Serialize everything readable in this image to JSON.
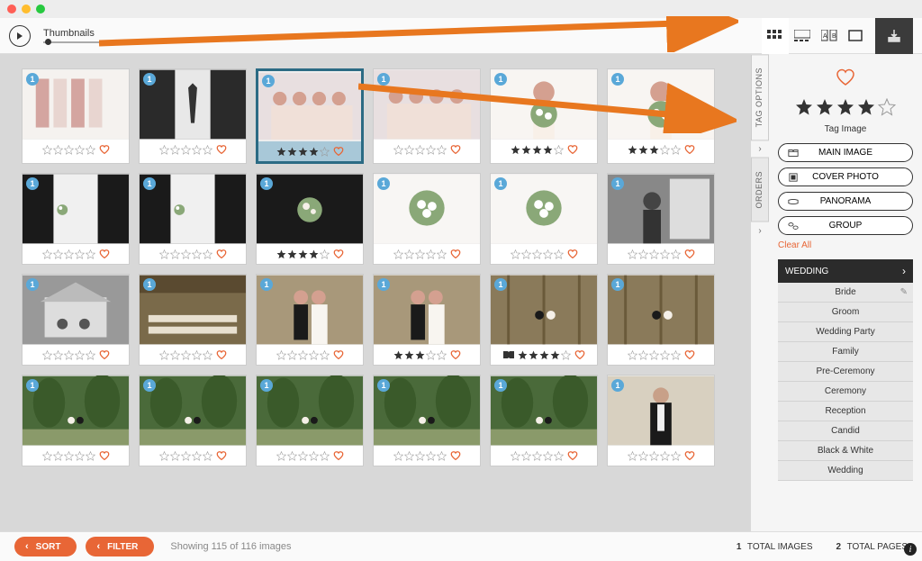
{
  "toolbar": {
    "thumbnails_label": "Thumbnails"
  },
  "side": {
    "tab_tag": "TAG OPTIONS",
    "tab_orders": "ORDERS",
    "tag_image_label": "Tag Image",
    "btn_main": "MAIN IMAGE",
    "btn_cover": "COVER PHOTO",
    "btn_pano": "PANORAMA",
    "btn_group": "GROUP",
    "clear_all": "Clear All",
    "category_header": "WEDDING",
    "categories": [
      "Bride",
      "Groom",
      "Wedding Party",
      "Family",
      "Pre-Ceremony",
      "Ceremony",
      "Reception",
      "Candid",
      "Black & White",
      "Wedding"
    ]
  },
  "footer": {
    "sort": "SORT",
    "filter": "FILTER",
    "status": "Showing 115 of 116 images",
    "total_images_n": "1",
    "total_images": "TOTAL IMAGES",
    "total_pages_n": "2",
    "total_pages": "TOTAL PAGES"
  },
  "thumbnails": [
    {
      "badge": "1",
      "rating": 0,
      "type": "dresses"
    },
    {
      "badge": "1",
      "rating": 0,
      "type": "groom-tie"
    },
    {
      "badge": "1",
      "rating": 4,
      "type": "bridesmaids",
      "selected": true
    },
    {
      "badge": "1",
      "rating": 0,
      "type": "bridesmaids2"
    },
    {
      "badge": "1",
      "rating": 4,
      "type": "bride-bouquet"
    },
    {
      "badge": "1",
      "rating": 3,
      "type": "bride-bouquet2"
    },
    {
      "badge": "1",
      "rating": 0,
      "type": "groom-pin"
    },
    {
      "badge": "1",
      "rating": 0,
      "type": "groom-pin2"
    },
    {
      "badge": "1",
      "rating": 4,
      "type": "bouton"
    },
    {
      "badge": "1",
      "rating": 0,
      "type": "bouquet-white"
    },
    {
      "badge": "1",
      "rating": 0,
      "type": "bouquet-white2"
    },
    {
      "badge": "1",
      "rating": 0,
      "type": "bride-window"
    },
    {
      "badge": "1",
      "rating": 0,
      "type": "house-bw"
    },
    {
      "badge": "1",
      "rating": 0,
      "type": "tables"
    },
    {
      "badge": "1",
      "rating": 0,
      "type": "couple-bouquet"
    },
    {
      "badge": "1",
      "rating": 3,
      "type": "couple-kiss"
    },
    {
      "badge": "1",
      "rating": 4,
      "type": "barn-couple",
      "book": true
    },
    {
      "badge": "1",
      "rating": 0,
      "type": "barn-window"
    },
    {
      "badge": "1",
      "rating": 0,
      "type": "field1"
    },
    {
      "badge": "1",
      "rating": 0,
      "type": "forest1"
    },
    {
      "badge": "1",
      "rating": 0,
      "type": "forest2"
    },
    {
      "badge": "1",
      "rating": 0,
      "type": "forest3"
    },
    {
      "badge": "1",
      "rating": 0,
      "type": "forest4"
    },
    {
      "badge": "1",
      "rating": 0,
      "type": "groom-solo"
    }
  ]
}
